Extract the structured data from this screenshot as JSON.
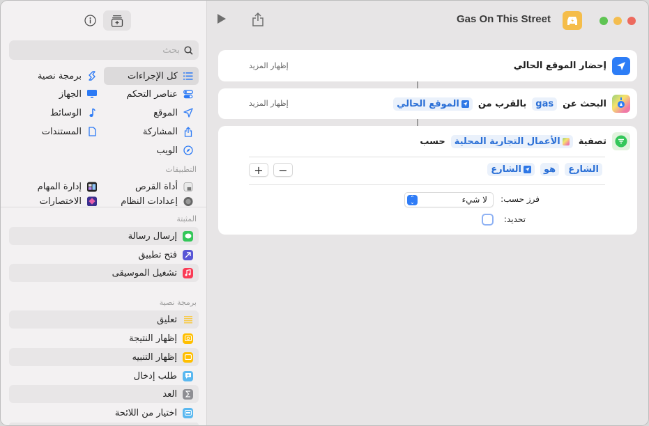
{
  "window": {
    "title": "Gas On This Street",
    "traffic_lights": {
      "green": "#5fc453",
      "yellow": "#f4bd4f",
      "red": "#ed6a5e"
    }
  },
  "toolbar": {
    "run_icon": "play-icon",
    "share_icon": "share-icon",
    "app_icon": "car-bolt-icon",
    "app_icon_color": "#f5bd4a"
  },
  "sidebar": {
    "top_buttons": [
      {
        "name": "info-icon"
      },
      {
        "name": "action-library-icon"
      }
    ],
    "search_placeholder": "بحث",
    "categories": [
      {
        "label": "كل الإجراءات",
        "icon": "list-icon",
        "selected": true
      },
      {
        "label": "برمجة نصية",
        "icon": "scripting-icon"
      },
      {
        "label": "عناصر التحكم",
        "icon": "toggles-icon"
      },
      {
        "label": "الجهاز",
        "icon": "monitor-icon"
      },
      {
        "label": "الموقع",
        "icon": "location-arrow-icon"
      },
      {
        "label": "الوسائط",
        "icon": "music-note-icon"
      },
      {
        "label": "المشاركة",
        "icon": "share-icon"
      },
      {
        "label": "المستندات",
        "icon": "document-icon"
      },
      {
        "label": "الويب",
        "icon": "compass-icon"
      }
    ],
    "apps_header": "التطبيقات",
    "apps": [
      {
        "label": "أداة القرص",
        "icon": "disk-utility-icon"
      },
      {
        "label": "إدارة المهام",
        "icon": "mission-control-icon"
      },
      {
        "label": "إعدادات النظام",
        "icon": "system-settings-icon"
      },
      {
        "label": "الاختصارات",
        "icon": "shortcuts-icon"
      }
    ],
    "pinned_header": "المثبتة",
    "pinned": [
      {
        "label": "إرسال رسالة",
        "icon": "messages-icon",
        "color": "#34c759"
      },
      {
        "label": "فتح تطبيق",
        "icon": "open-app-arrow-icon",
        "color": "#5856d6"
      },
      {
        "label": "تشغيل الموسيقى",
        "icon": "music-icon",
        "color": "#fa3b55"
      }
    ],
    "scripting_header": "برمجة نصية",
    "scripting": [
      {
        "label": "تعليق",
        "icon": "comment-lines-icon",
        "color": "#f7c948"
      },
      {
        "label": "إظهار النتيجة",
        "icon": "show-result-icon",
        "color": "#ffbf00"
      },
      {
        "label": "إظهار التنبيه",
        "icon": "alert-icon",
        "color": "#ffbf00"
      },
      {
        "label": "طلب إدخال",
        "icon": "ask-input-icon",
        "color": "#5ab8f0"
      },
      {
        "label": "العد",
        "icon": "sigma-icon",
        "color": "#8e8e93"
      },
      {
        "label": "اختيار من اللائحة",
        "icon": "choose-list-icon",
        "color": "#5ab8f0"
      }
    ]
  },
  "actions": [
    {
      "title": "إحضار الموقع الحالي",
      "icon": "location-arrow-icon",
      "show_more": "إظهار المزيد"
    },
    {
      "parts": [
        "البحث عن",
        "gas",
        "بالقرب من",
        "الموقع الحالي"
      ],
      "icon": "maps-icon",
      "show_more": "إظهار المزيد"
    },
    {
      "parts": [
        "تصفية",
        "الأعمال التجارية المحلية",
        "حسب"
      ],
      "icon": "filter-icon",
      "condition": [
        "الشارع",
        "هو",
        "الشارع"
      ],
      "add_label": "+",
      "remove_label": "−",
      "sort_label": "فرز حسب:",
      "sort_value": "لا شيء",
      "limit_label": "تحديد:",
      "limit_checked": false
    }
  ]
}
